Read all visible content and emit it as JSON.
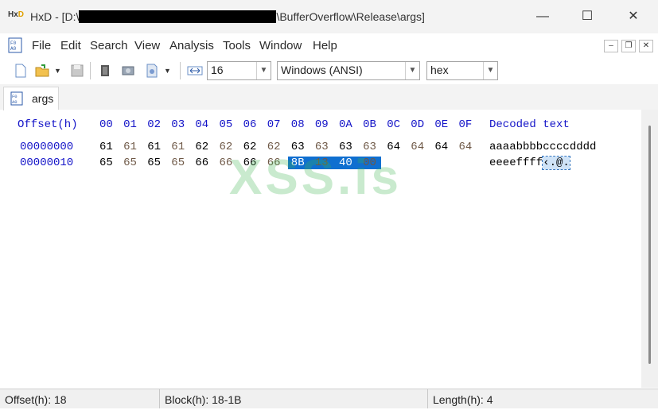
{
  "window": {
    "title_prefix": "HxD - [D:\\",
    "title_suffix": "\\BufferOverflow\\Release\\args]",
    "minimize": "—",
    "maximize": "☐",
    "close": "✕"
  },
  "menu": [
    "File",
    "Edit",
    "Search",
    "View",
    "Analysis",
    "Tools",
    "Window",
    "Help"
  ],
  "mdi_controls": {
    "minimize": "–",
    "restore": "❐",
    "close": "✕"
  },
  "toolbar": {
    "bytes_per_row": "16",
    "charset": "Windows (ANSI)",
    "offset_base": "hex"
  },
  "tab": {
    "label": "args"
  },
  "editor": {
    "offset_header": "Offset(h)",
    "columns": [
      "00",
      "01",
      "02",
      "03",
      "04",
      "05",
      "06",
      "07",
      "08",
      "09",
      "0A",
      "0B",
      "0C",
      "0D",
      "0E",
      "0F"
    ],
    "decoded_header": "Decoded text",
    "rows": [
      {
        "offset": "00000000",
        "bytes": [
          "61",
          "61",
          "61",
          "61",
          "62",
          "62",
          "62",
          "62",
          "63",
          "63",
          "63",
          "63",
          "64",
          "64",
          "64",
          "64"
        ],
        "text": "aaaabbbbccccdddd",
        "text_selected": ""
      },
      {
        "offset": "00000010",
        "bytes": [
          "65",
          "65",
          "65",
          "65",
          "66",
          "66",
          "66",
          "66",
          "8B",
          "13",
          "40",
          "00"
        ],
        "text": "eeeeffff",
        "text_selected": "‹.@."
      }
    ],
    "selection": {
      "row": 1,
      "start": 8,
      "end": 11
    }
  },
  "watermark": "XSS.is",
  "status": {
    "offset": "Offset(h): 18",
    "block": "Block(h): 18-1B",
    "length": "Length(h): 4"
  },
  "colors": {
    "offset_blue": "#1414c8",
    "selection_bg": "#0f6fd0",
    "alt_byte": "#6e5846"
  }
}
